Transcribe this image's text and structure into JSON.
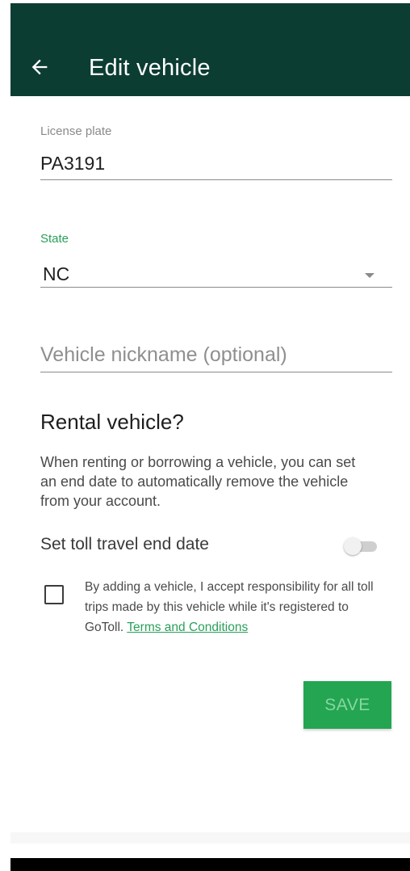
{
  "appbar": {
    "title": "Edit vehicle",
    "back_icon": "arrow-left-icon"
  },
  "license_plate": {
    "label": "License plate",
    "value": "PA3191"
  },
  "state": {
    "label": "State",
    "value": "NC",
    "arrow_icon": "dropdown-arrow-icon"
  },
  "nickname": {
    "placeholder": "Vehicle nickname (optional)",
    "value": ""
  },
  "rental": {
    "title": "Rental vehicle?",
    "description": "When renting or borrowing a vehicle, you can set an end date to automatically remove the vehicle from your account."
  },
  "toll_end_date": {
    "label": "Set toll travel end date",
    "enabled": false
  },
  "consent": {
    "checked": false,
    "text": "By adding a vehicle, I accept responsibility for all toll trips made by this vehicle while it's registered to GoToll. ",
    "link_text": "Terms and Conditions"
  },
  "save_button": {
    "label": "SAVE",
    "enabled": false
  },
  "colors": {
    "appbar": "#0c3d33",
    "accent": "#2aa05a",
    "save_button": "#23a552"
  }
}
